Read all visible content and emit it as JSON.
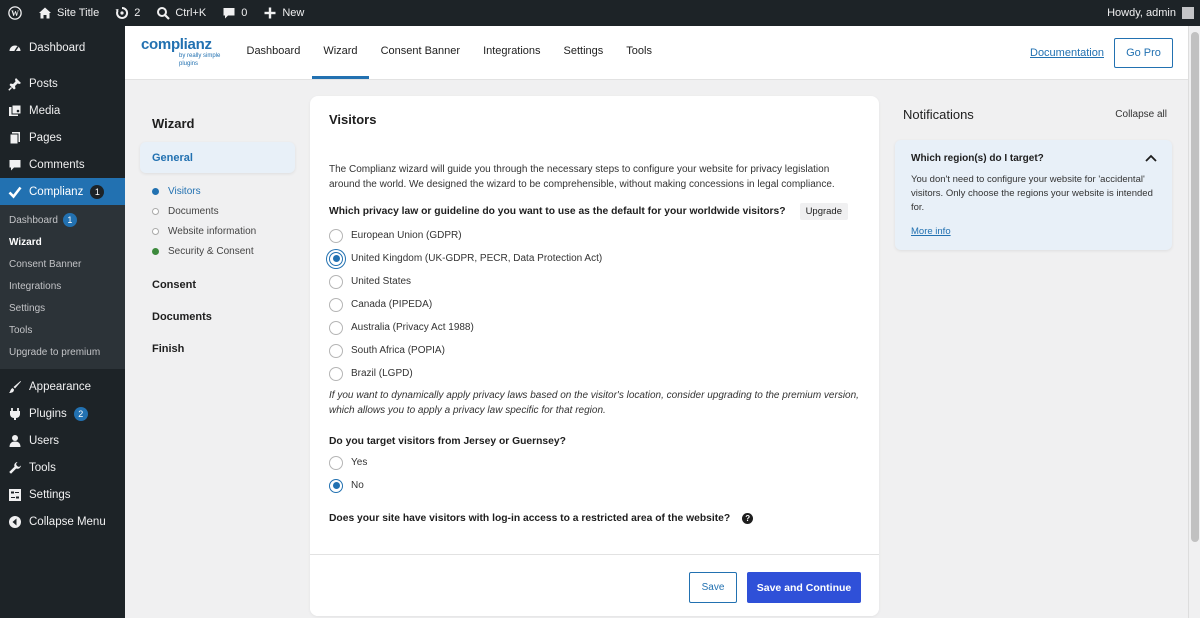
{
  "admin_bar": {
    "site_title": "Site Title",
    "updates_count": "2",
    "search_shortcut": "Ctrl+K",
    "comments_count": "0",
    "new_label": "New",
    "howdy": "Howdy, admin"
  },
  "sidebar": {
    "items": [
      {
        "label": "Dashboard",
        "icon": "dashboard-icon"
      },
      {
        "label": "Posts",
        "icon": "pin-icon"
      },
      {
        "label": "Media",
        "icon": "media-icon"
      },
      {
        "label": "Pages",
        "icon": "pages-icon"
      },
      {
        "label": "Comments",
        "icon": "comment-icon"
      },
      {
        "label": "Complianz",
        "icon": "check-icon",
        "badge": "1"
      }
    ],
    "submenu": [
      {
        "label": "Dashboard",
        "badge": "1"
      },
      {
        "label": "Wizard"
      },
      {
        "label": "Consent Banner"
      },
      {
        "label": "Integrations"
      },
      {
        "label": "Settings"
      },
      {
        "label": "Tools"
      },
      {
        "label": "Upgrade to premium"
      }
    ],
    "lower_items": [
      {
        "label": "Appearance",
        "icon": "brush-icon"
      },
      {
        "label": "Plugins",
        "icon": "plugin-icon",
        "badge": "2"
      },
      {
        "label": "Users",
        "icon": "user-icon"
      },
      {
        "label": "Tools",
        "icon": "wrench-icon"
      },
      {
        "label": "Settings",
        "icon": "settings-icon"
      },
      {
        "label": "Collapse Menu",
        "icon": "collapse-icon"
      }
    ]
  },
  "header": {
    "logo_word": "complianz",
    "logo_by": "by really simple plugins",
    "tabs": [
      "Dashboard",
      "Wizard",
      "Consent Banner",
      "Integrations",
      "Settings",
      "Tools"
    ],
    "documentation": "Documentation",
    "go_pro": "Go Pro"
  },
  "wizard_nav": {
    "title": "Wizard",
    "general": "General",
    "steps": [
      "Visitors",
      "Documents",
      "Website information",
      "Security & Consent"
    ],
    "groups": [
      "Consent",
      "Documents",
      "Finish"
    ]
  },
  "main": {
    "title": "Visitors",
    "intro": "The Complianz wizard will guide you through the necessary steps to configure your website for privacy legislation around the world. We designed the wizard to be comprehensible, without making concessions in legal compliance.",
    "q1": "Which privacy law or guideline do you want to use as the default for your worldwide visitors?",
    "upgrade": "Upgrade",
    "q1_options": [
      "European Union (GDPR)",
      "United Kingdom (UK-GDPR, PECR, Data Protection Act)",
      "United States",
      "Canada (PIPEDA)",
      "Australia (Privacy Act 1988)",
      "South Africa (POPIA)",
      "Brazil (LGPD)"
    ],
    "q1_selected": "United Kingdom (UK-GDPR, PECR, Data Protection Act)",
    "note": "If you want to dynamically apply privacy laws based on the visitor's location, consider upgrading to the premium version, which allows you to apply a privacy law specific for that region.",
    "q2": "Do you target visitors from Jersey or Guernsey?",
    "q2_options": [
      "Yes",
      "No"
    ],
    "q2_selected": "No",
    "q3": "Does your site have visitors with log-in access to a restricted area of the website?",
    "save": "Save",
    "save_continue": "Save and Continue"
  },
  "notifications": {
    "title": "Notifications",
    "collapse_all": "Collapse all",
    "card_title": "Which region(s) do I target?",
    "card_text": "You don't need to configure your website for 'accidental' visitors. Only choose the regions your website is intended for.",
    "more_info": "More info"
  },
  "colors": {
    "wp_dark": "#1d2327",
    "wp_blue": "#2271b1",
    "primary_button": "#2f50d8",
    "notice_bg": "#e8f0f8"
  }
}
